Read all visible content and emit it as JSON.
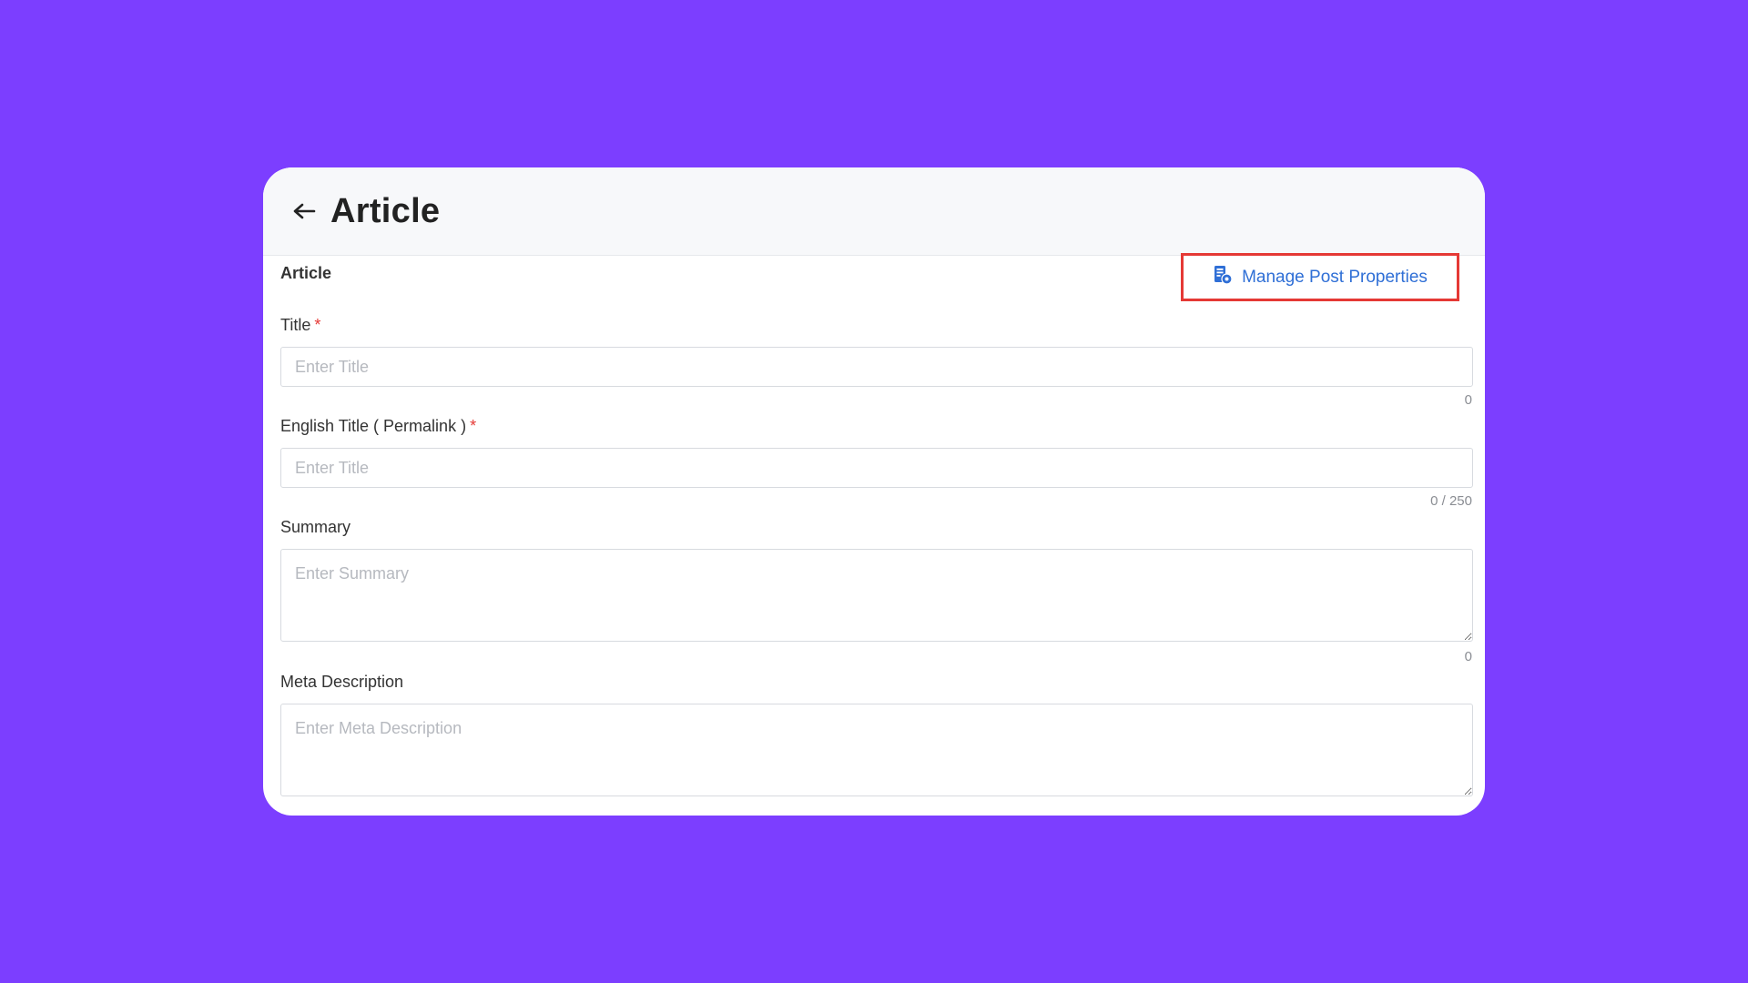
{
  "header": {
    "title": "Article"
  },
  "section": {
    "label": "Article"
  },
  "toolbar": {
    "manage_label": "Manage Post Properties",
    "manage_icon": "document-settings-icon",
    "accent_color": "#2f6fd6",
    "highlight_color": "#e53935"
  },
  "fields": {
    "title": {
      "label": "Title",
      "required_mark": "*",
      "placeholder": "Enter Title",
      "value": "",
      "counter": "0"
    },
    "english_title": {
      "label": "English Title ( Permalink )",
      "required_mark": "*",
      "placeholder": "Enter Title",
      "value": "",
      "counter": "0 / 250"
    },
    "summary": {
      "label": "Summary",
      "placeholder": "Enter Summary",
      "value": "",
      "counter": "0"
    },
    "meta_description": {
      "label": "Meta Description",
      "placeholder": "Enter Meta Description",
      "value": ""
    }
  },
  "colors": {
    "background": "#7c3eff",
    "required": "#e53935"
  }
}
